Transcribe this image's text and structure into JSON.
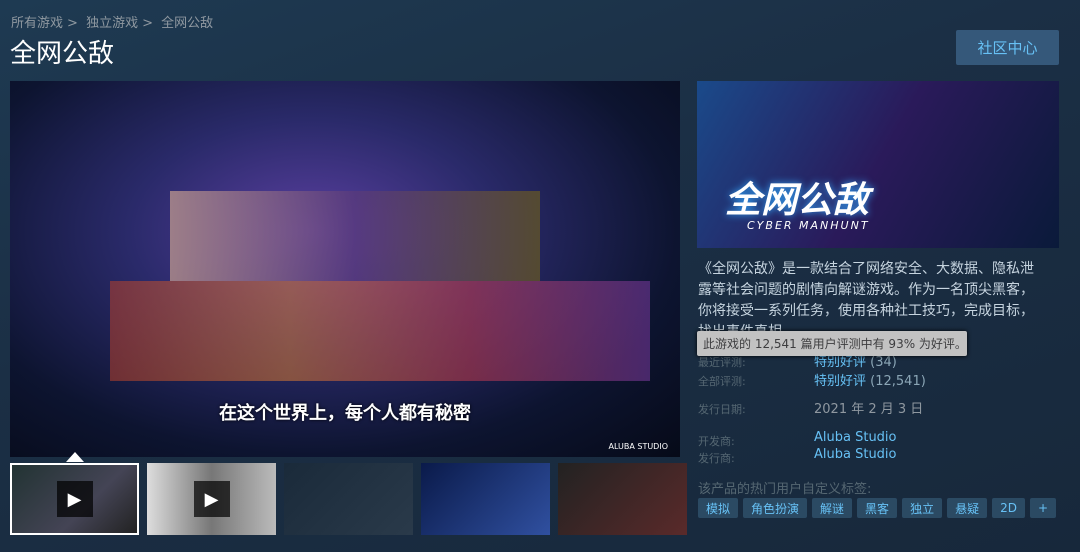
{
  "breadcrumb": [
    "所有游戏",
    "独立游戏",
    "全网公敌"
  ],
  "breadcrumb_sep": ">",
  "title": "全网公敌",
  "community_button": "社区中心",
  "media": {
    "subtitle": "在这个世界上，每个人都有秘密",
    "studio_watermark": "ALUBA STUDIO",
    "thumbnails": 5,
    "selected_thumbnail": 1,
    "play_icon": "play-icon"
  },
  "capsule": {
    "logo": "全网公敌",
    "logo_sub": "CYBER MANHUNT"
  },
  "description": "《全网公敌》是一款结合了网络安全、大数据、隐私泄露等社会问题的剧情向解谜游戏。作为一名顶尖黑客，你将接受一系列任务，使用各种社工技巧，完成目标，找出事件真相。",
  "tooltip": "此游戏的 12,541 篇用户评测中有 93% 为好评。",
  "reviews": {
    "recent_label": "最近评测:",
    "recent_value": "特别好评",
    "recent_count": "(34)",
    "all_label": "全部评测:",
    "all_value": "特别好评",
    "all_count": "(12,541)"
  },
  "release": {
    "label": "发行日期:",
    "value": "2021 年 2 月 3 日"
  },
  "developer": {
    "label": "开发商:",
    "value": "Aluba Studio"
  },
  "publisher": {
    "label": "发行商:",
    "value": "Aluba Studio"
  },
  "tags_header": "该产品的热门用户自定义标签:",
  "tags": [
    "模拟",
    "角色扮演",
    "解谜",
    "黑客",
    "独立",
    "悬疑",
    "2D",
    "+"
  ]
}
